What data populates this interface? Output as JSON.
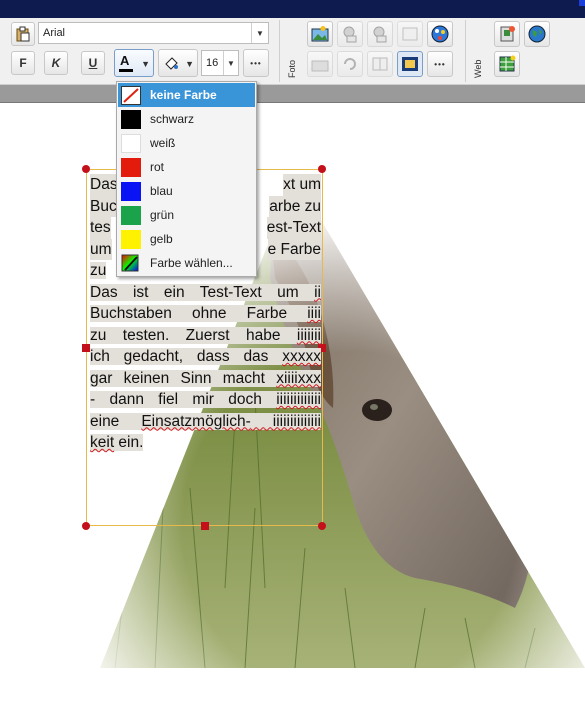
{
  "toolbar": {
    "font_name": "Arial",
    "font_size": "16",
    "bold_label": "F",
    "italic_label": "K",
    "underline_label": "U",
    "text_color_label": "A",
    "more_label": "•••",
    "group_foto": "Foto",
    "group_web": "Web"
  },
  "color_menu": {
    "items": [
      {
        "label": "keine Farbe",
        "color": "none"
      },
      {
        "label": "schwarz",
        "color": "#000000"
      },
      {
        "label": "weiß",
        "color": "#ffffff"
      },
      {
        "label": "rot",
        "color": "#e21b0c"
      },
      {
        "label": "blau",
        "color": "#0a13f4"
      },
      {
        "label": "grün",
        "color": "#1aa34a"
      },
      {
        "label": "gelb",
        "color": "#fff200"
      },
      {
        "label": "Farbe wählen...",
        "color": "picker"
      }
    ]
  },
  "document": {
    "p1_l1_a": "Das",
    "p1_l1_b": "xt um",
    "p1_l2_a": "Buc",
    "p1_l2_b": "arbe zu",
    "p1_l3_a": "tes",
    "p1_l3_b": "est-Text",
    "p1_l4_a": "um",
    "p1_l4_b": "e Farbe",
    "p1_l5_a": "zu",
    "p2": [
      [
        "Das ist ein Test-Text um ",
        "ii"
      ],
      [
        "Buchstaben ohne Farbe ",
        "iiii"
      ],
      [
        "zu testen. Zuerst habe ",
        "iiiiiii"
      ],
      [
        "ich gedacht, dass das ",
        "xxxxx"
      ],
      [
        "gar keinen Sinn macht ",
        "xiiiixxx"
      ],
      [
        "- dann fiel mir doch ",
        "iiiiiiiiiiiii"
      ],
      [
        "eine ",
        "Einsatzmöglich-",
        " iiiiiiiiiiiiii"
      ],
      [
        "",
        "keit",
        " ein."
      ]
    ]
  }
}
